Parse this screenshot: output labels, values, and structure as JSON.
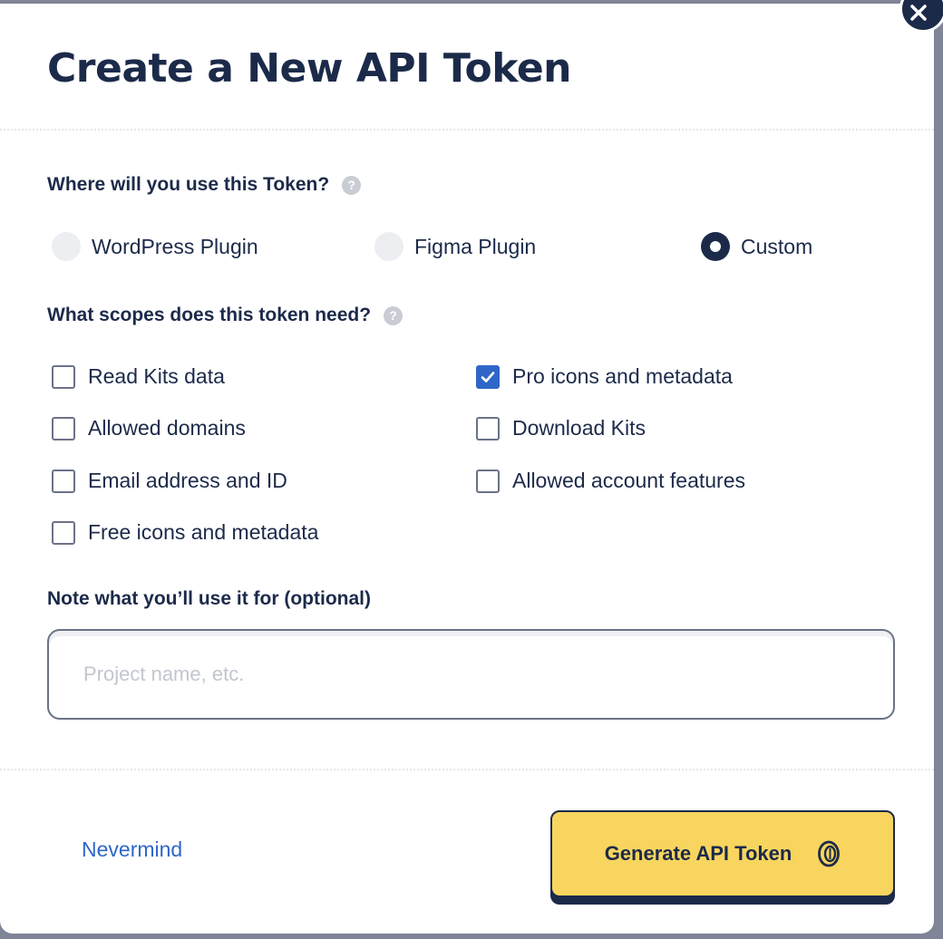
{
  "dialog": {
    "title": "Create a New API Token"
  },
  "usage": {
    "label": "Where will you use this Token?",
    "help": "?",
    "options": [
      {
        "label": "WordPress Plugin",
        "selected": false
      },
      {
        "label": "Figma Plugin",
        "selected": false
      },
      {
        "label": "Custom",
        "selected": true
      }
    ]
  },
  "scopes": {
    "label": "What scopes does this token need?",
    "help": "?",
    "items": [
      {
        "label": "Read Kits data",
        "checked": false
      },
      {
        "label": "Pro icons and metadata",
        "checked": true
      },
      {
        "label": "Allowed domains",
        "checked": false
      },
      {
        "label": "Download Kits",
        "checked": false
      },
      {
        "label": "Email address and ID",
        "checked": false
      },
      {
        "label": "Allowed account features",
        "checked": false
      },
      {
        "label": "Free icons and metadata",
        "checked": false
      }
    ]
  },
  "note": {
    "label": "Note what you’ll use it for (optional)",
    "placeholder": "Project name, etc.",
    "value": ""
  },
  "footer": {
    "cancel_label": "Nevermind",
    "submit_label": "Generate API Token"
  },
  "colors": {
    "navy": "#1c2a4a",
    "accent_yellow": "#f8d55e",
    "link_blue": "#2f66c8",
    "checkbox_checked": "#2f66c8"
  },
  "icons": {
    "close": "close-icon",
    "help": "help-icon",
    "check": "check-icon",
    "coin": "coin-icon"
  }
}
